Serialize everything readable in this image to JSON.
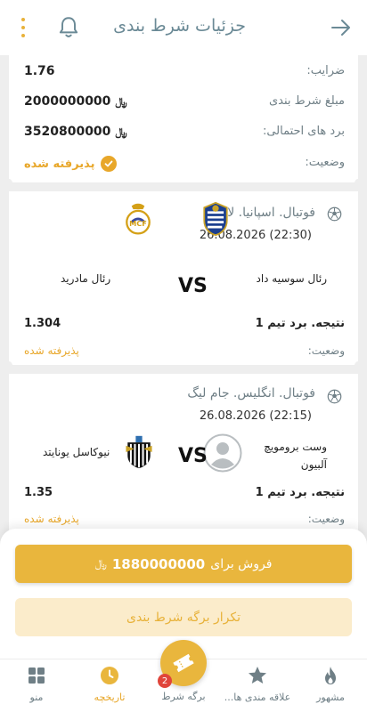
{
  "header": {
    "title": "جزئیات شرط بندی"
  },
  "summary": {
    "odds_label": "ضرایب:",
    "odds_value": "1.76",
    "amount_label": "مبلغ شرط بندی",
    "amount_value": "2000000000",
    "win_label": "برد های احتمالی:",
    "win_value": "3520800000",
    "status_label": "وضعیت:",
    "status_value": "پذیرفته شده",
    "currency": "﷼"
  },
  "matches": [
    {
      "league": "فوتبال. اسپانیا. لا لیگا",
      "datetime": "26.08.2026 (22:30)",
      "home_team": "رئال سوسیه داد",
      "away_team": "رئال مادرید",
      "vs": "VS",
      "pick": "نتیجه. برد تیم 1",
      "odds": "1.304",
      "status_label": "وضعیت:",
      "status": "پذیرفته شده"
    },
    {
      "league": "فوتبال. انگلیس. جام لیگ",
      "datetime": "26.08.2026 (22:15)",
      "home_team_line1": "وست برومویچ",
      "home_team_line2": "آلبیون",
      "away_team": "نیوکاسل یونایتد",
      "vs": "VS",
      "pick": "نتیجه. برد تیم 1",
      "odds": "1.35",
      "status_label": "وضعیت:",
      "status": "پذیرفته شده"
    }
  ],
  "actions": {
    "sell_label": "فروش برای",
    "sell_amount": "1880000000",
    "repeat_label": "تکرار برگه شرط بندی"
  },
  "nav": {
    "popular": "مشهور",
    "favorites": "علاقه مندی ها...",
    "betslip": "برگه شرط",
    "betslip_badge": "2",
    "history": "تاریخچه",
    "menu": "منو"
  },
  "colors": {
    "accent": "#e9b63d",
    "text_muted": "#6f7f86"
  }
}
